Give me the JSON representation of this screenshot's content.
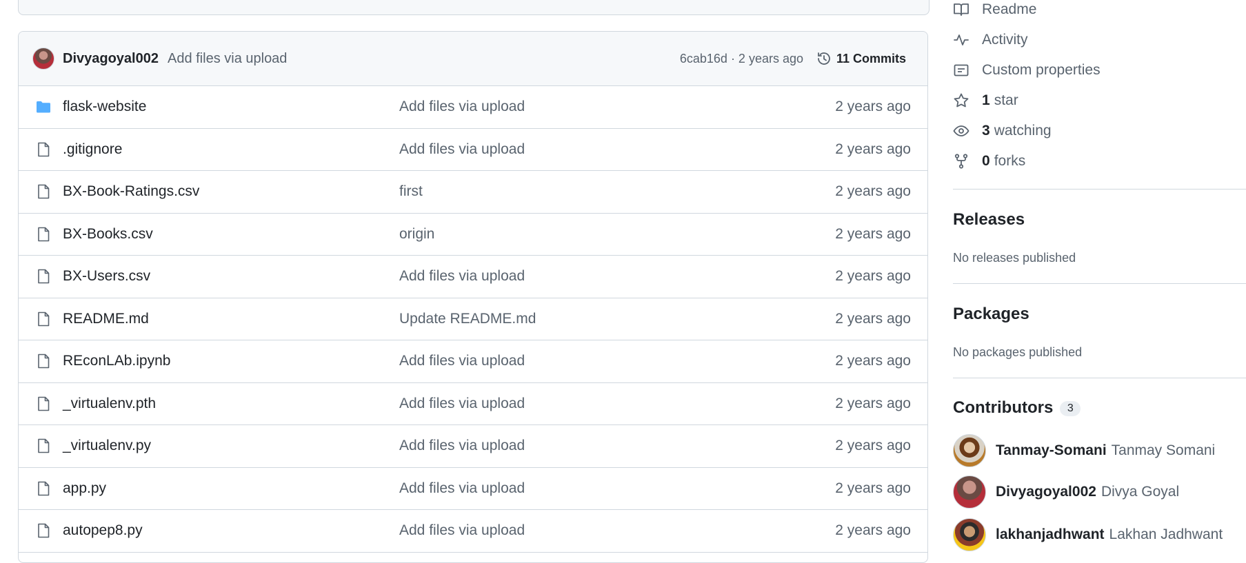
{
  "commit": {
    "author": "Divyagoyal002",
    "message": "Add files via upload",
    "meta": "6cab16d · 2 years ago",
    "commits_label": "11 Commits"
  },
  "files": [
    {
      "name": "flask-website",
      "message": "Add files via upload",
      "age": "2 years ago",
      "type": "folder"
    },
    {
      "name": ".gitignore",
      "message": "Add files via upload",
      "age": "2 years ago",
      "type": "file"
    },
    {
      "name": "BX-Book-Ratings.csv",
      "message": "first",
      "age": "2 years ago",
      "type": "file"
    },
    {
      "name": "BX-Books.csv",
      "message": "origin",
      "age": "2 years ago",
      "type": "file"
    },
    {
      "name": "BX-Users.csv",
      "message": "Add files via upload",
      "age": "2 years ago",
      "type": "file"
    },
    {
      "name": "README.md",
      "message": "Update README.md",
      "age": "2 years ago",
      "type": "file"
    },
    {
      "name": "REconLAb.ipynb",
      "message": "Add files via upload",
      "age": "2 years ago",
      "type": "file"
    },
    {
      "name": "_virtualenv.pth",
      "message": "Add files via upload",
      "age": "2 years ago",
      "type": "file"
    },
    {
      "name": "_virtualenv.py",
      "message": "Add files via upload",
      "age": "2 years ago",
      "type": "file"
    },
    {
      "name": "app.py",
      "message": "Add files via upload",
      "age": "2 years ago",
      "type": "file"
    },
    {
      "name": "autopep8.py",
      "message": "Add files via upload",
      "age": "2 years ago",
      "type": "file"
    }
  ],
  "sidebar": {
    "readme": "Readme",
    "activity": "Activity",
    "custom_properties": "Custom properties",
    "stars_count": "1",
    "stars_label": "star",
    "watching_count": "3",
    "watching_label": "watching",
    "forks_count": "0",
    "forks_label": "forks",
    "releases_title": "Releases",
    "releases_sub": "No releases published",
    "packages_title": "Packages",
    "packages_sub": "No packages published",
    "contributors_title": "Contributors",
    "contributors_count": "3",
    "contributors": [
      {
        "login": "Tanmay-Somani",
        "name": "Tanmay Somani"
      },
      {
        "login": "Divyagoyal002",
        "name": "Divya Goyal"
      },
      {
        "login": "lakhanjadhwant",
        "name": "Lakhan Jadhwant"
      }
    ]
  },
  "colors": {
    "folder": "#54aeff",
    "accent": "#1f2328",
    "muted": "#59636e",
    "border": "#d0d7de"
  }
}
